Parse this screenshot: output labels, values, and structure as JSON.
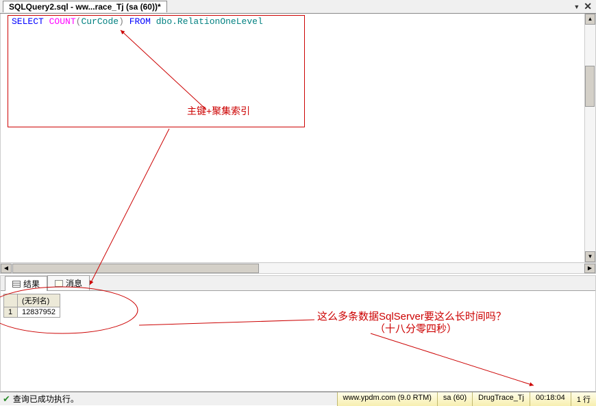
{
  "tab": {
    "title": "SQLQuery2.sql - ww...race_Tj (sa (60))*"
  },
  "sql": {
    "select": "SELECT",
    "count": "COUNT",
    "col": "CurCode",
    "from": "FROM",
    "table": "dbo.RelationOneLevel"
  },
  "annotations": {
    "topBox": "主键+聚集索引",
    "question1": "这么多条数据SqlServer要这么长时间吗？",
    "question2": "（十八分零四秒）"
  },
  "resultsTabs": {
    "results": "结果",
    "messages": "消息"
  },
  "resultGrid": {
    "header": "(无列名)",
    "row": "1",
    "value": "12837952"
  },
  "status": {
    "success": "查询已成功执行。",
    "server": "www.ypdm.com (9.0 RTM)",
    "user": "sa (60)",
    "database": "DrugTrace_Tj",
    "time": "00:18:04",
    "rows": "1 行"
  }
}
